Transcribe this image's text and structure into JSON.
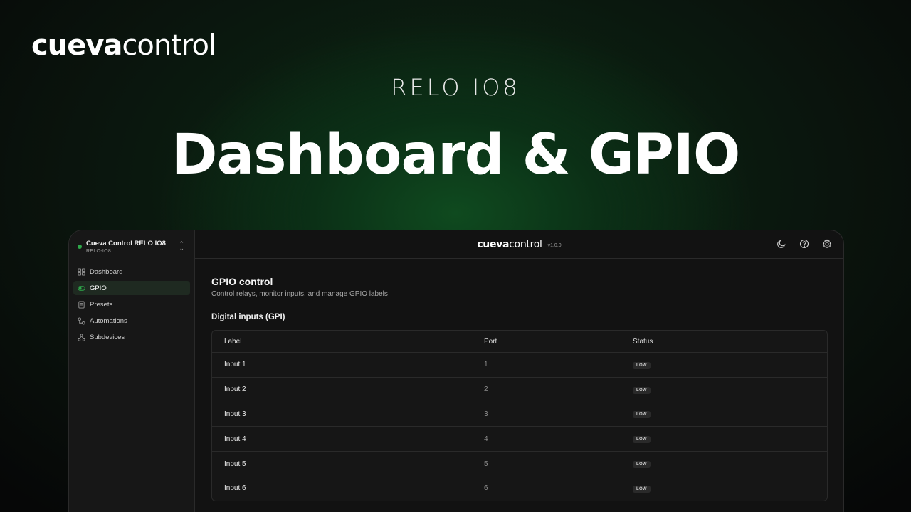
{
  "hero": {
    "brand_bold": "cueva",
    "brand_light": "control",
    "subtitle": "RELO IO8",
    "headline": "Dashboard & GPIO"
  },
  "sidebar": {
    "device_name": "Cueva Control RELO IO8",
    "device_id": "RELO-IO8",
    "status_color": "#2ea84a",
    "items": [
      {
        "label": "Dashboard",
        "icon": "grid-icon",
        "active": false
      },
      {
        "label": "GPIO",
        "icon": "toggle-icon",
        "active": true
      },
      {
        "label": "Presets",
        "icon": "document-icon",
        "active": false
      },
      {
        "label": "Automations",
        "icon": "workflow-icon",
        "active": false
      },
      {
        "label": "Subdevices",
        "icon": "network-icon",
        "active": false
      }
    ]
  },
  "topbar": {
    "logo_bold": "cueva",
    "logo_light": "control",
    "version": "v1.0.0",
    "icons": [
      "moon-icon",
      "help-icon",
      "settings-icon"
    ]
  },
  "main": {
    "title": "GPIO control",
    "description": "Control relays, monitor inputs, and manage GPIO labels",
    "section_title": "Digital inputs (GPI)",
    "table": {
      "headers": [
        "Label",
        "Port",
        "Status"
      ],
      "rows": [
        {
          "label": "Input 1",
          "port": "1",
          "status": "LOW"
        },
        {
          "label": "Input 2",
          "port": "2",
          "status": "LOW"
        },
        {
          "label": "Input 3",
          "port": "3",
          "status": "LOW"
        },
        {
          "label": "Input 4",
          "port": "4",
          "status": "LOW"
        },
        {
          "label": "Input 5",
          "port": "5",
          "status": "LOW"
        },
        {
          "label": "Input 6",
          "port": "6",
          "status": "LOW"
        }
      ]
    }
  }
}
